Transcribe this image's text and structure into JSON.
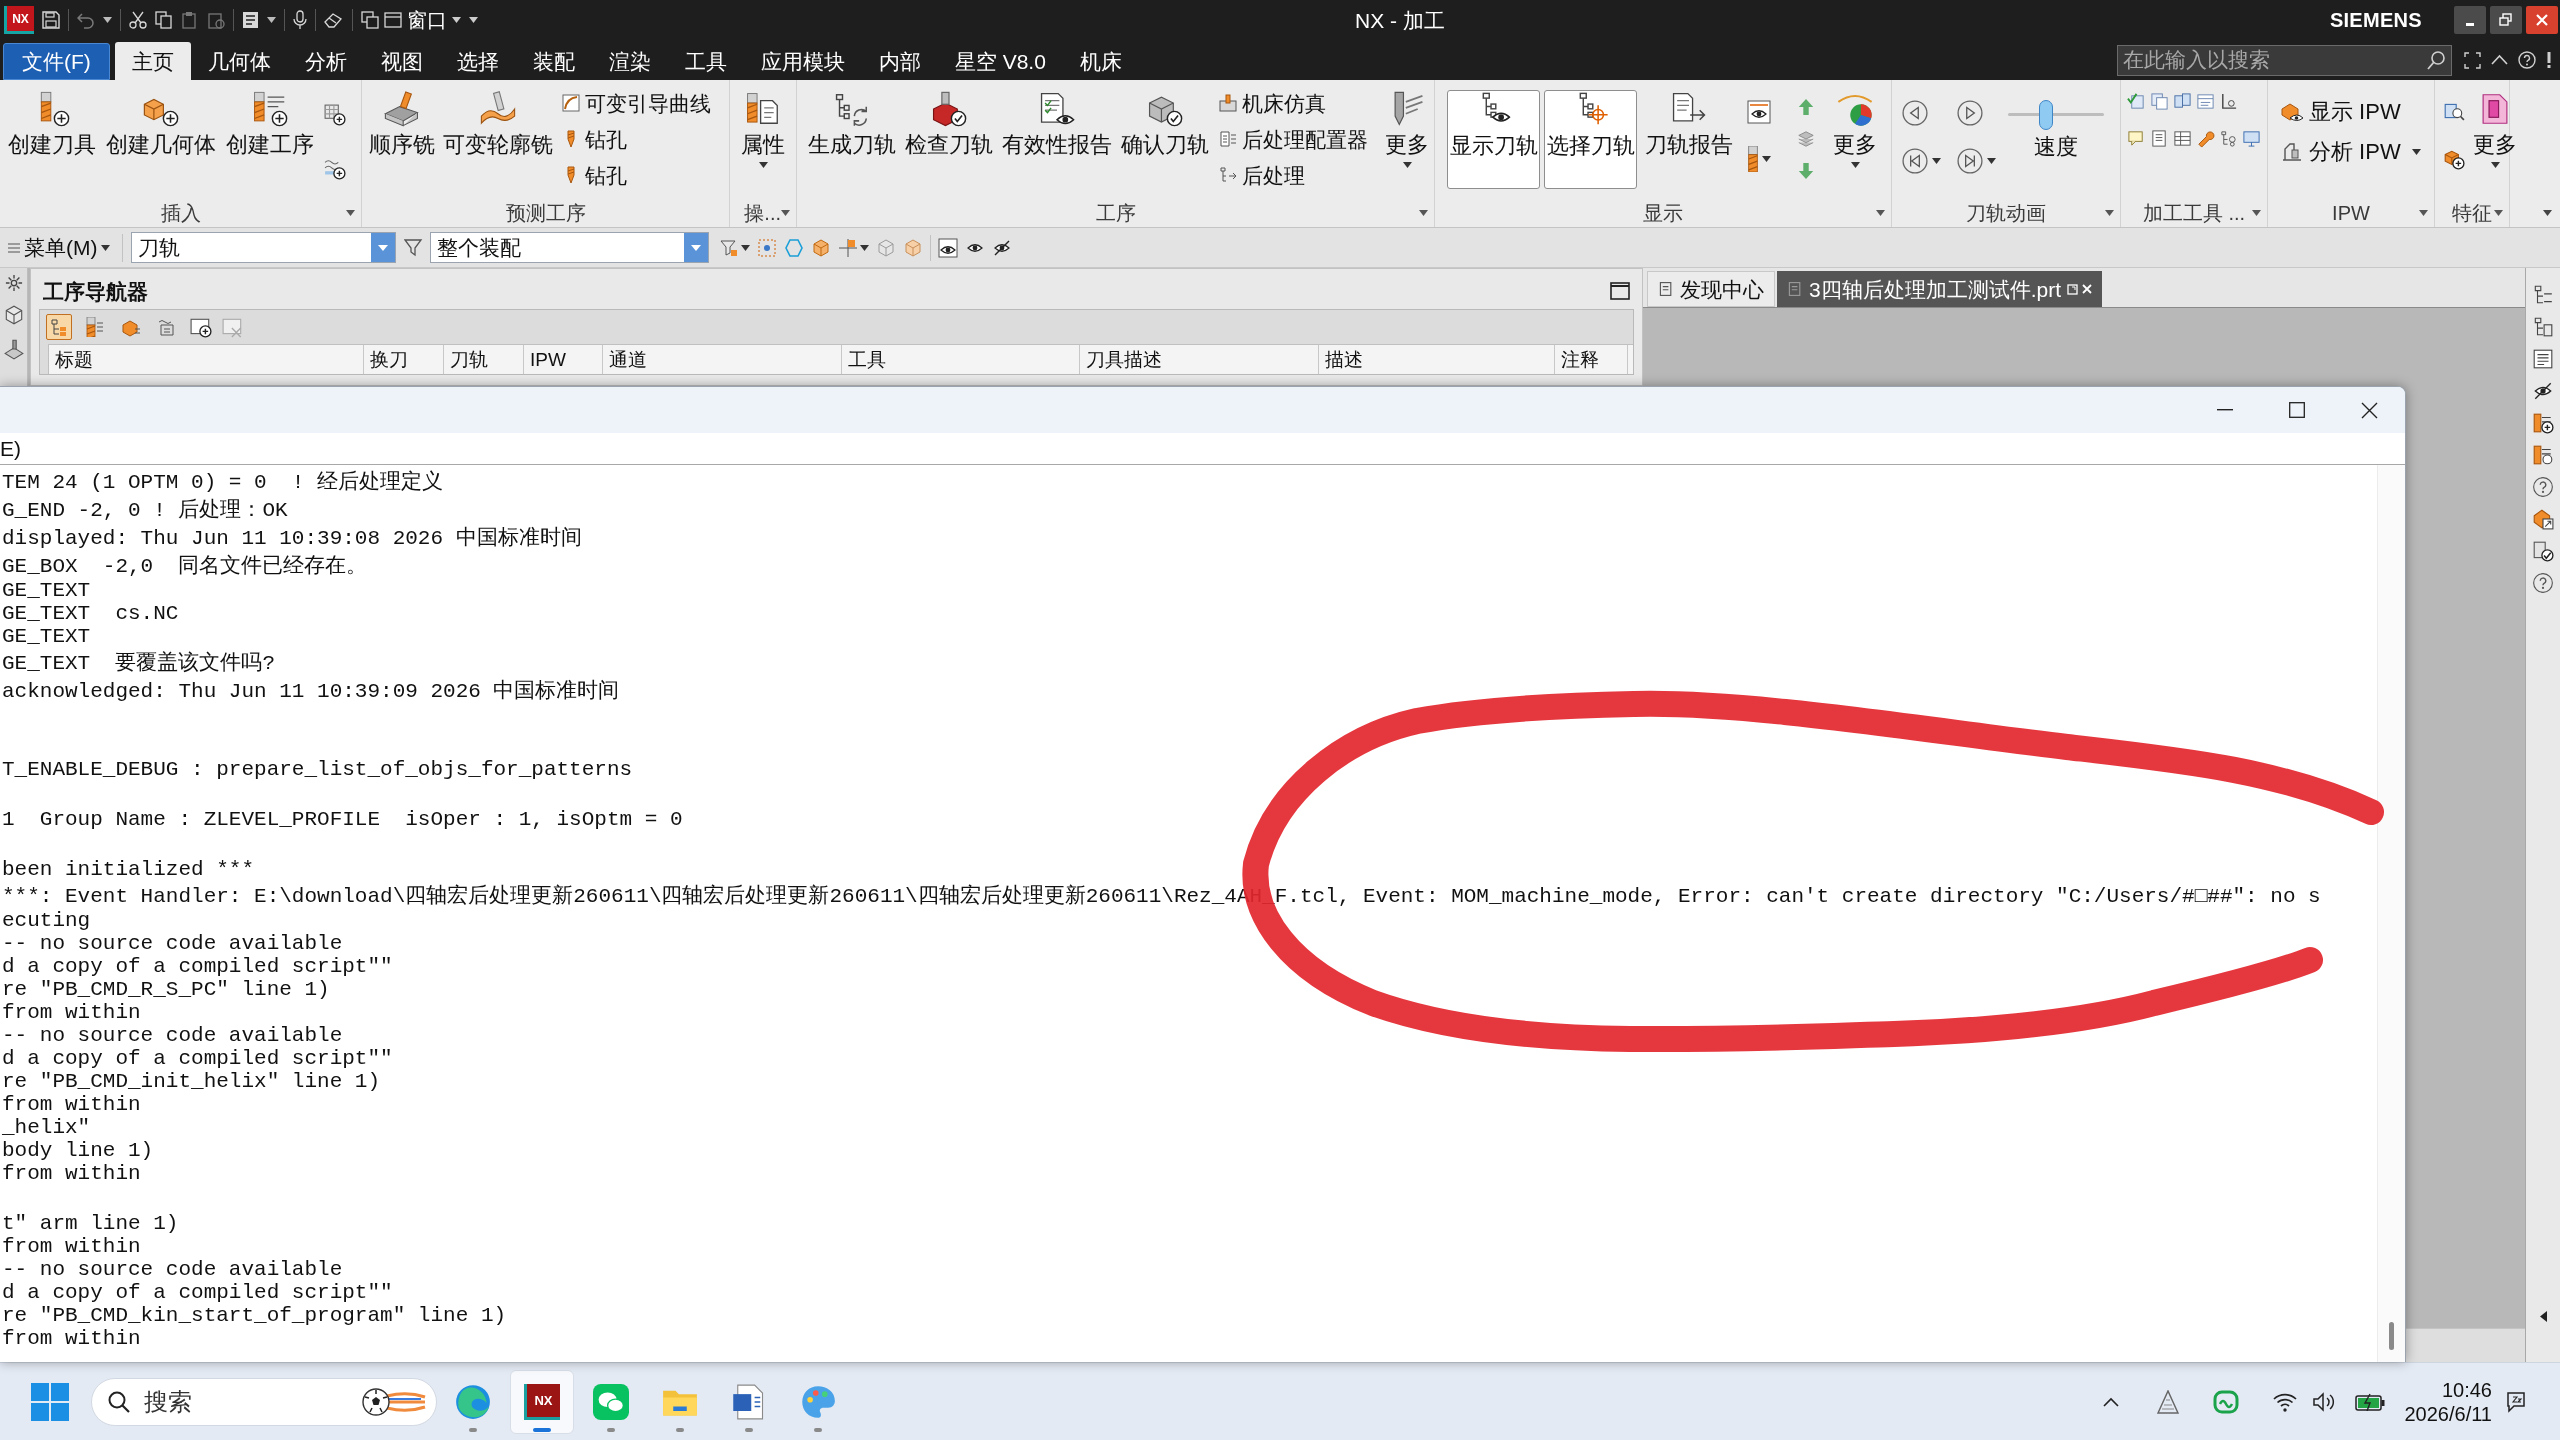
{
  "title_bar": {
    "logo": "NX",
    "window_menu": "窗口",
    "title": "NX - 加工",
    "brand": "SIEMENS"
  },
  "menu_tabs": [
    {
      "label": "文件(F)",
      "kind": "file",
      "selected": false
    },
    {
      "label": "主页",
      "kind": "tab",
      "selected": true
    },
    {
      "label": "几何体",
      "kind": "tab",
      "selected": false
    },
    {
      "label": "分析",
      "kind": "tab",
      "selected": false
    },
    {
      "label": "视图",
      "kind": "tab",
      "selected": false
    },
    {
      "label": "选择",
      "kind": "tab",
      "selected": false
    },
    {
      "label": "装配",
      "kind": "tab",
      "selected": false
    },
    {
      "label": "渲染",
      "kind": "tab",
      "selected": false
    },
    {
      "label": "工具",
      "kind": "tab",
      "selected": false
    },
    {
      "label": "应用模块",
      "kind": "tab",
      "selected": false
    },
    {
      "label": "内部",
      "kind": "tab",
      "selected": false
    },
    {
      "label": "星空 V8.0",
      "kind": "tab",
      "selected": false
    },
    {
      "label": "机床",
      "kind": "tab",
      "selected": false
    }
  ],
  "search": {
    "placeholder": "在此输入以搜索"
  },
  "ribbon": {
    "groups": [
      {
        "kind": "insert",
        "label": "插入",
        "buttons": [
          "创建刀具",
          "创建几何体",
          "创建工序"
        ]
      },
      {
        "kind": "predict",
        "label": "预测工序",
        "buttons": [
          "顺序铣",
          "可变轮廓铣"
        ],
        "small_buttons": [
          "可变引导曲线",
          "钻孔",
          "钻孔"
        ]
      },
      {
        "kind": "operate",
        "label": "操...",
        "buttons": [
          "属性"
        ]
      },
      {
        "kind": "process",
        "label": "工序",
        "buttons": [
          "生成刀轨",
          "检查刀轨",
          "有效性报告",
          "确认刀轨"
        ],
        "small_buttons": [
          "机床仿真",
          "后处理配置器",
          "后处理"
        ],
        "more": "更多"
      },
      {
        "kind": "display",
        "label": "显示",
        "toggles": [
          {
            "label": "显示刀轨",
            "on": true
          },
          {
            "label": "选择刀轨",
            "on": true
          }
        ],
        "buttons": [
          "刀轨报告"
        ],
        "more": "更多"
      },
      {
        "kind": "animation",
        "label": "刀轨动画",
        "speed": {
          "label": "速度",
          "level": 0.4
        }
      },
      {
        "kind": "tools",
        "label": "加工工具 ..."
      },
      {
        "kind": "ipw",
        "label": "IPW",
        "buttons": [
          "显示 IPW",
          "分析 IPW"
        ]
      },
      {
        "kind": "feature",
        "label": "特征",
        "more": "更多"
      }
    ]
  },
  "toolbar": {
    "menu": "菜单(M)",
    "type_filter": "刀轨",
    "scope": "整个装配"
  },
  "operation_navigator": {
    "title": "工序导航器",
    "view_buttons": [
      {
        "selected": true
      },
      {
        "selected": false
      },
      {
        "selected": false
      },
      {
        "selected": false
      }
    ],
    "columns": [
      "标题",
      "换刀",
      "刀轨",
      "IPW",
      "通道",
      "工具",
      "刀具描述",
      "描述",
      "注释"
    ]
  },
  "graphics_tabs": [
    {
      "label": "发现中心",
      "selected": false
    },
    {
      "label": "3四轴后处理加工测试件.prt",
      "selected": true
    }
  ],
  "info_window": {
    "menu": [
      "E)"
    ],
    "lines": [
      {
        "kind": "text",
        "text": "TEM 24 (1 OPTM 0) = 0  ! 经后处理定义"
      },
      {
        "kind": "text",
        "text": "G_END -2, 0 ! 后处理：OK"
      },
      {
        "kind": "text",
        "text": "displayed: Thu Jun 11 10:39:08 2026 中国标准时间"
      },
      {
        "kind": "text",
        "text": "GE_BOX  -2,0  同名文件已经存在。"
      },
      {
        "kind": "text",
        "text": "GE_TEXT"
      },
      {
        "kind": "text",
        "text": "GE_TEXT  cs.NC"
      },
      {
        "kind": "text",
        "text": "GE_TEXT"
      },
      {
        "kind": "text",
        "text": "GE_TEXT  要覆盖该文件吗?"
      },
      {
        "kind": "text",
        "text": "acknowledged: Thu Jun 11 10:39:09 2026 中国标准时间"
      },
      {
        "kind": "blank"
      },
      {
        "kind": "blank"
      },
      {
        "kind": "text",
        "text": "T_ENABLE_DEBUG : prepare_list_of_objs_for_patterns"
      },
      {
        "kind": "blank"
      },
      {
        "kind": "text",
        "text": "1  Group Name : ZLEVEL_PROFILE  isOper : 1, isOptm = 0"
      },
      {
        "kind": "blank"
      },
      {
        "kind": "text",
        "text": "been initialized ***"
      },
      {
        "kind": "text",
        "text": "***: Event Handler: E:\\download\\四轴宏后处理更新260611\\四轴宏后处理更新260611\\四轴宏后处理更新260611\\Rez_4AH_F.tcl, Event: MOM_machine_mode, Error: can't create directory \"C:/Users/#□##\": no s"
      },
      {
        "kind": "text",
        "text": "ecuting"
      },
      {
        "kind": "text",
        "text": "-- no source code available"
      },
      {
        "kind": "text",
        "text": "d a copy of a compiled script\"\""
      },
      {
        "kind": "text",
        "text": "re \"PB_CMD_R_S_PC\" line 1)"
      },
      {
        "kind": "text",
        "text": "from within"
      },
      {
        "kind": "text",
        "text": "-- no source code available"
      },
      {
        "kind": "text",
        "text": "d a copy of a compiled script\"\""
      },
      {
        "kind": "text",
        "text": "re \"PB_CMD_init_helix\" line 1)"
      },
      {
        "kind": "text",
        "text": "from within"
      },
      {
        "kind": "text",
        "text": "_helix\""
      },
      {
        "kind": "text",
        "text": "body line 1)"
      },
      {
        "kind": "text",
        "text": "from within"
      },
      {
        "kind": "blank"
      },
      {
        "kind": "text",
        "text": "t\" arm line 1)"
      },
      {
        "kind": "text",
        "text": "from within"
      },
      {
        "kind": "text",
        "text": "-- no source code available"
      },
      {
        "kind": "text",
        "text": "d a copy of a compiled script\"\""
      },
      {
        "kind": "text",
        "text": "re \"PB_CMD_kin_start_of_program\" line 1)"
      },
      {
        "kind": "text",
        "text": "from within"
      }
    ]
  },
  "taskbar": {
    "search": {
      "placeholder": "搜索"
    },
    "apps": [
      {
        "kind": "browser",
        "selected": false
      },
      {
        "kind": "nx",
        "label": "NX",
        "selected": true
      },
      {
        "kind": "chat",
        "selected": false
      },
      {
        "kind": "folder",
        "selected": false
      },
      {
        "kind": "document",
        "selected": false
      },
      {
        "kind": "palette",
        "selected": false
      }
    ],
    "time": "10:46",
    "date": "2026/6/11"
  }
}
